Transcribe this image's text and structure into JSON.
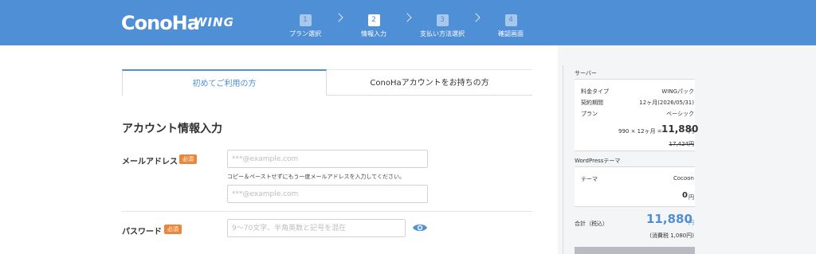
{
  "header": {
    "logo": "ConoHa",
    "logo_sub": "WING",
    "steps": [
      {
        "num": "1",
        "label": "プラン選択"
      },
      {
        "num": "2",
        "label": "情報入力"
      },
      {
        "num": "3",
        "label": "支払い方法選択"
      },
      {
        "num": "4",
        "label": "確認画面"
      }
    ],
    "active_step": 2
  },
  "tabs": {
    "first": "初めてご利用の方",
    "second": "ConoHaアカウントをお持ちの方"
  },
  "form": {
    "title": "アカウント情報入力",
    "email_label": "メールアドレス",
    "required": "必須",
    "email_placeholder": "***@example.com",
    "email_hint": "コピー＆ペーストせずにもう一度メールアドレスを入力してください。",
    "email_confirm_placeholder": "***@example.com",
    "password_label": "パスワード",
    "password_placeholder": "9〜70文字、半角英数と記号を混在"
  },
  "summary": {
    "server_heading": "サーバー",
    "rows": [
      {
        "label": "料金タイプ",
        "value": "WINGパック"
      },
      {
        "label": "契約期間",
        "value": "12ヶ月(2026/05/31)"
      },
      {
        "label": "プラン",
        "value": "ベーシック"
      }
    ],
    "price_calc": "990 × 12ヶ月 =",
    "price_value": "11,880",
    "yen": "円",
    "original_price": "17,424円",
    "wp_heading": "WordPressテーマ",
    "theme_label": "テーマ",
    "theme_value": "Cocoon",
    "theme_price": "0",
    "total_label": "合計（税込）",
    "total_value": "11,880",
    "tax_note": "(消費税 1,080円)"
  },
  "colors": {
    "brand": "#4f8fd6",
    "required_badge": "#e9883a"
  }
}
